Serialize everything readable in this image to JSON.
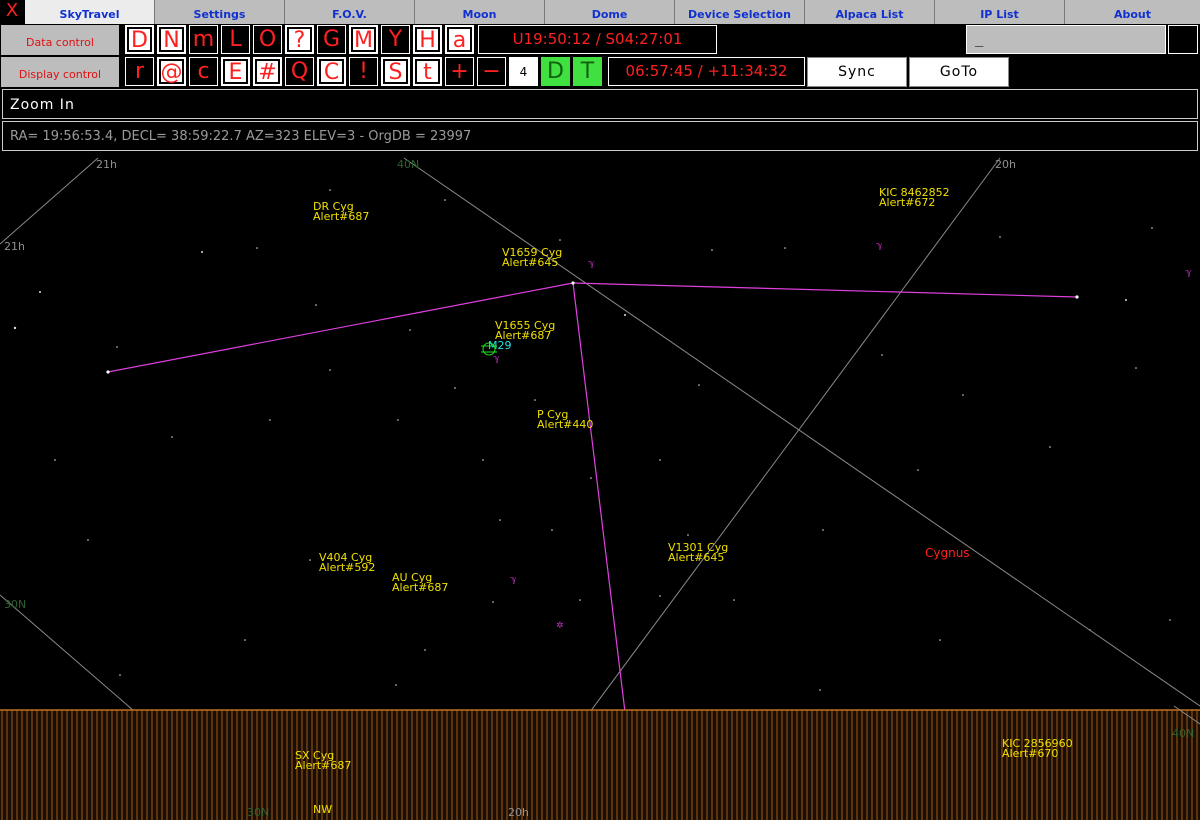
{
  "tabs": [
    "SkyTravel",
    "Settings",
    "F.O.V.",
    "Moon",
    "Dome",
    "Device Selection",
    "Alpaca List",
    "IP List",
    "About"
  ],
  "active_tab": "SkyTravel",
  "close_label": "X",
  "data_control": {
    "label": "Data control",
    "toggles": [
      "D",
      "N",
      "m",
      "L",
      "O",
      "?",
      "G",
      "M",
      "Y",
      "H",
      "a"
    ],
    "coord": "U19:50:12 / S04:27:01",
    "input_value": "_"
  },
  "display_control": {
    "label": "Display control",
    "toggles": [
      "r",
      "@",
      "c",
      "E",
      "#",
      "Q",
      "C",
      "!",
      "S",
      "t",
      "+",
      "−"
    ],
    "number": "4",
    "green_toggles": [
      "D",
      "T"
    ],
    "coord": "06:57:45 / +11:34:32",
    "sync_label": "Sync",
    "goto_label": "GoTo"
  },
  "command_text": "Zoom In",
  "info_text": "RA= 19:56:53.4, DECL= 38:59:22.7 AZ=323 ELEV=3 - OrgDB = 23997",
  "sky_objects": [
    {
      "name": "DR Cyg",
      "alert": "Alert#687"
    },
    {
      "name": "KIC 8462852",
      "alert": "Alert#672"
    },
    {
      "name": "V1659 Cyg",
      "alert": "Alert#645"
    },
    {
      "name": "V1655 Cyg",
      "alert": "Alert#687"
    },
    {
      "name": "P Cyg",
      "alert": "Alert#440"
    },
    {
      "name": "V404 Cyg",
      "alert": "Alert#592"
    },
    {
      "name": "AU Cyg",
      "alert": "Alert#687"
    },
    {
      "name": "V1301 Cyg",
      "alert": "Alert#645"
    },
    {
      "name": "SX Cyg",
      "alert": "Alert#687"
    },
    {
      "name": "KIC 2856960",
      "alert": "Alert#670"
    }
  ],
  "messier_label": "M29",
  "constellation_label": "Cygnus",
  "grid_labels": {
    "ra_21h_top": "21h",
    "ra_21h_left": "21h",
    "dec_40n_top": "40N",
    "ra_20h_top": "20h",
    "dec_30n_left": "30N",
    "dec_30n_bottom": "30N",
    "ra_20h_bottom": "20h",
    "dec_40n_right": "40N"
  },
  "horizon_label": "NW",
  "colors": {
    "constellation_line": "#e040e0",
    "grid": "#8a8a8a",
    "horizon": "#c07020",
    "label": "#f0e000",
    "messier": "#20e0e0",
    "alert_red": "#ff2020"
  }
}
